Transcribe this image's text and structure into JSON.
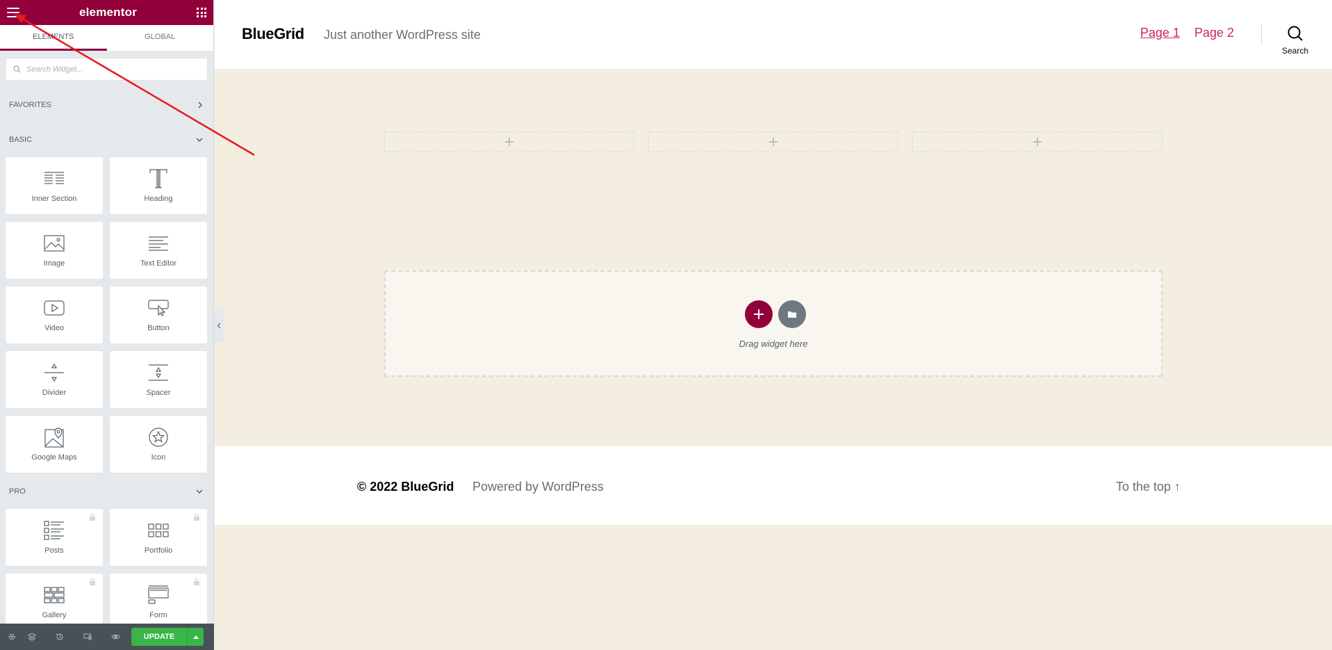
{
  "sidebar": {
    "brand": "elementor",
    "tabs": [
      {
        "label": "Elements",
        "active": true
      },
      {
        "label": "Global",
        "active": false
      }
    ],
    "search": {
      "placeholder": "Search Widget..."
    },
    "categories": {
      "favorites": "Favorites",
      "basic": "Basic",
      "pro": "Pro"
    },
    "basic_widgets": [
      {
        "label": "Inner Section",
        "icon": "inner-section-icon"
      },
      {
        "label": "Heading",
        "icon": "heading-icon"
      },
      {
        "label": "Image",
        "icon": "image-icon"
      },
      {
        "label": "Text Editor",
        "icon": "text-editor-icon"
      },
      {
        "label": "Video",
        "icon": "video-icon"
      },
      {
        "label": "Button",
        "icon": "button-icon"
      },
      {
        "label": "Divider",
        "icon": "divider-icon"
      },
      {
        "label": "Spacer",
        "icon": "spacer-icon"
      },
      {
        "label": "Google Maps",
        "icon": "google-maps-icon"
      },
      {
        "label": "Icon",
        "icon": "star-icon"
      }
    ],
    "pro_widgets": [
      {
        "label": "Posts",
        "icon": "posts-icon",
        "locked": true
      },
      {
        "label": "Portfolio",
        "icon": "portfolio-icon",
        "locked": true
      },
      {
        "label": "Gallery",
        "icon": "gallery-icon",
        "locked": true
      },
      {
        "label": "Form",
        "icon": "form-icon",
        "locked": true
      }
    ],
    "footer": {
      "update_label": "Update",
      "tools": [
        "settings-icon",
        "navigator-icon",
        "history-icon",
        "responsive-icon",
        "preview-icon"
      ]
    }
  },
  "site": {
    "title": "BlueGrid",
    "description": "Just another WordPress site",
    "nav": [
      "Page 1",
      "Page 2"
    ],
    "search_label": "Search"
  },
  "canvas": {
    "drop_text": "Drag widget here"
  },
  "footer": {
    "copyright": "© 2022 BlueGrid",
    "powered": "Powered by WordPress",
    "to_top": "To the top ↑"
  },
  "colors": {
    "brand": "#92003b",
    "nav_link": "#cd2653",
    "page_bg": "#f3eee0",
    "update_green": "#39b54a",
    "annotation": "#e8191f"
  }
}
